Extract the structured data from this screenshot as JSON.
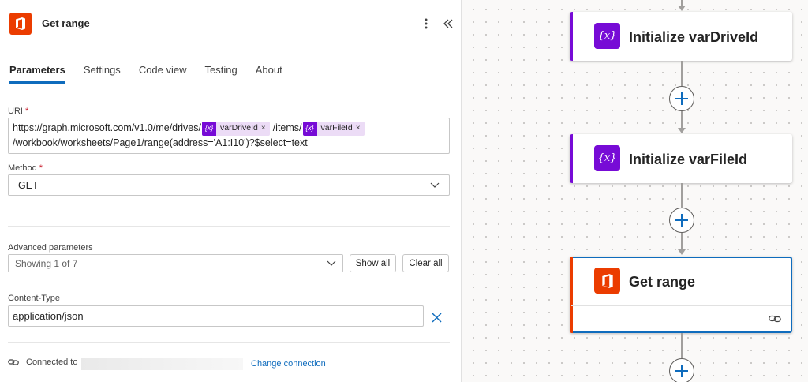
{
  "panel": {
    "title": "Get range",
    "tabs": [
      {
        "label": "Parameters",
        "active": true
      },
      {
        "label": "Settings",
        "active": false
      },
      {
        "label": "Code view",
        "active": false
      },
      {
        "label": "Testing",
        "active": false
      },
      {
        "label": "About",
        "active": false
      }
    ],
    "uri": {
      "label": "URI",
      "required_mark": "*",
      "line1_prefix": "https://graph.microsoft.com/v1.0/me/drives/",
      "token1": "varDriveId",
      "line1_middle": "/items/",
      "token2": "varFileId",
      "line2": "/workbook/worksheets/Page1/range(address='A1:I10')?$select=text",
      "token_icon": "{x}",
      "token_remove": "×"
    },
    "method": {
      "label": "Method",
      "required_mark": "*",
      "value": "GET"
    },
    "advanced": {
      "label": "Advanced parameters",
      "value": "Showing 1 of 7",
      "show_all": "Show all",
      "clear_all": "Clear all"
    },
    "content_type": {
      "label": "Content-Type",
      "value": "application/json"
    },
    "connection": {
      "label": "Connected to",
      "change_link": "Change connection"
    }
  },
  "canvas": {
    "cards": [
      {
        "title": "Initialize varDriveId",
        "icon": "variable-icon",
        "accent": "#770bd6"
      },
      {
        "title": "Initialize varFileId",
        "icon": "variable-icon",
        "accent": "#770bd6"
      },
      {
        "title": "Get range",
        "icon": "office-icon",
        "accent": "#eb3c00",
        "selected": true
      }
    ],
    "variable_icon_text": "{x}"
  },
  "colors": {
    "office": "#eb3c00",
    "variable": "#770bd6",
    "accent_blue": "#0f6cbd",
    "selected_border": "#0f6cbd"
  }
}
